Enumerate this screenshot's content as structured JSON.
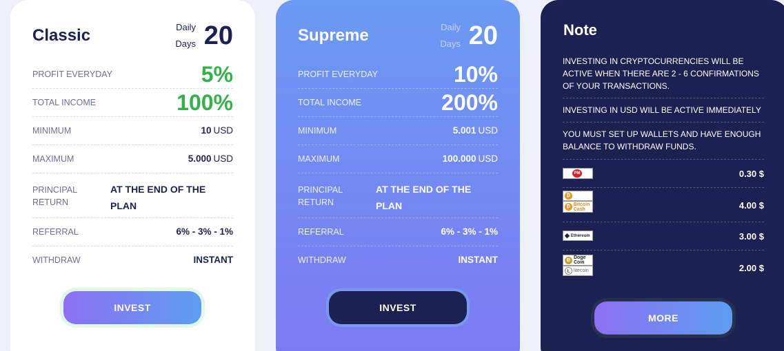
{
  "plans": [
    {
      "title": "Classic",
      "days_word_1": "Daily",
      "days_word_2": "Days",
      "days_num": "20",
      "profit_label": "PROFIT EVERYDAY",
      "profit": "5%",
      "income_label": "TOTAL INCOME",
      "income": "100%",
      "min_label": "MINIMUM",
      "min_value": "10",
      "min_unit": "USD",
      "max_label": "MAXIMUM",
      "max_value": "5.000",
      "max_unit": "USD",
      "principal_label": "PRINCIPAL RETURN",
      "principal_value": "AT THE END OF THE PLAN",
      "referral_label": "REFERRAL",
      "referral_value": "6% - 3% - 1%",
      "withdraw_label": "WITHDRAW",
      "withdraw_value": "INSTANT",
      "button": "INVEST"
    },
    {
      "title": "Supreme",
      "days_word_1": "Daily",
      "days_word_2": "Days",
      "days_num": "20",
      "profit_label": "PROFIT EVERYDAY",
      "profit": "10%",
      "income_label": "TOTAL INCOME",
      "income": "200%",
      "min_label": "MINIMUM",
      "min_value": "5.001",
      "min_unit": "USD",
      "max_label": "MAXIMUM",
      "max_value": "100.000",
      "max_unit": "USD",
      "principal_label": "PRINCIPAL RETURN",
      "principal_value": "AT THE END OF THE PLAN",
      "referral_label": "REFERRAL",
      "referral_value": "6% - 3% - 1%",
      "withdraw_label": "WITHDRAW",
      "withdraw_value": "INSTANT",
      "button": "INVEST"
    }
  ],
  "note": {
    "title": "Note",
    "paragraphs": [
      "INVESTING IN CRYPTOCURRENCIES WILL BE ACTIVE WHEN THERE ARE 2 - 6 CONFIRMATIONS OF YOUR TRANSACTIONS.",
      "INVESTING IN USD WILL BE ACTIVE IMMEDIATELY",
      "YOU MUST SET UP WALLETS AND HAVE ENOUGH BALANCE TO WITHDRAW FUNDS."
    ],
    "fees": [
      {
        "logos": [
          "PM"
        ],
        "amount": "0.30 $"
      },
      {
        "logos": [
          "bitcoin-logo",
          "Bitcoin Cash"
        ],
        "amount": "4.00 $"
      },
      {
        "logos": [
          "Ethereum"
        ],
        "amount": "3.00 $"
      },
      {
        "logos": [
          "Doge Coin",
          "litecoin"
        ],
        "amount": "2.00 $"
      }
    ],
    "button": "MORE"
  },
  "colors": {
    "navy": "#1b2150",
    "green": "#34b24a",
    "gradient_start": "#8c70f3",
    "gradient_end": "#5d9df1"
  }
}
